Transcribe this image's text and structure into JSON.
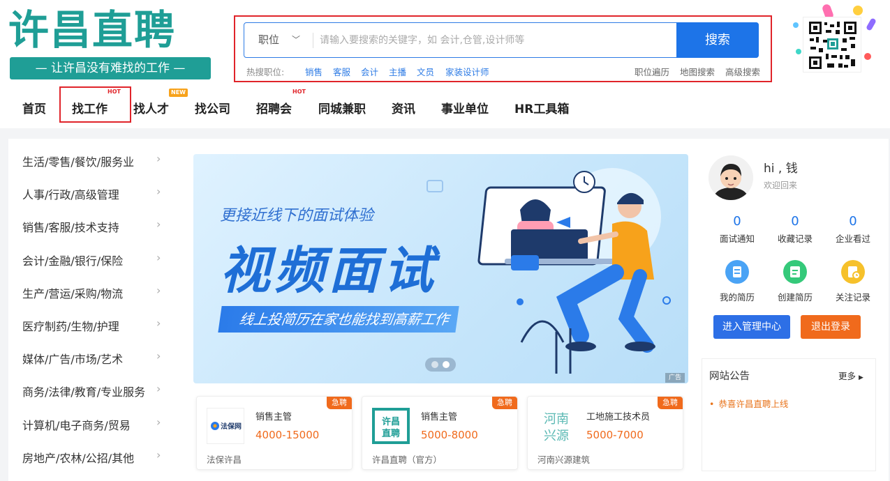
{
  "logo": {
    "title": "许昌直聘",
    "slogan": "— 让许昌没有难找的工作 —"
  },
  "search": {
    "type": "职位",
    "placeholder": "请输入要搜索的关键字，如 会计,仓管,设计师等",
    "button": "搜索",
    "hot_label": "热搜职位:",
    "hot_terms": [
      "销售",
      "客服",
      "会计",
      "主播",
      "文员",
      "家装设计师"
    ],
    "advanced": [
      "职位遍历",
      "地图搜索",
      "高级搜索"
    ]
  },
  "nav": {
    "items": [
      "首页",
      "找工作",
      "找人才",
      "找公司",
      "招聘会",
      "同城兼职",
      "资讯",
      "事业单位",
      "HR工具箱"
    ],
    "badges": {
      "find_job": "HOT",
      "find_talent": "NEW",
      "job_fair": "HOT"
    }
  },
  "categories": [
    "生活/零售/餐饮/服务业",
    "人事/行政/高级管理",
    "销售/客服/技术支持",
    "会计/金融/银行/保险",
    "生产/营运/采购/物流",
    "医疗制药/生物/护理",
    "媒体/广告/市场/艺术",
    "商务/法律/教育/专业服务",
    "计算机/电子商务/贸易",
    "房地产/农林/公招/其他"
  ],
  "banner": {
    "subtitle": "更接近线下的面试体验",
    "title": "视频面试",
    "tagline": "线上投简历在家也能找到高薪工作",
    "ad_label": "广告"
  },
  "jobs": [
    {
      "title": "销售主管",
      "salary": "4000-15000",
      "company": "法保许昌",
      "urgent": "急聘",
      "logo_text": "法保网"
    },
    {
      "title": "销售主管",
      "salary": "5000-8000",
      "company": "许昌直聘（官方）",
      "urgent": "急聘",
      "logo_text": "许昌直聘"
    },
    {
      "title": "工地施工技术员",
      "salary": "5000-7000",
      "company": "河南兴源建筑",
      "urgent": "急聘",
      "logo_text": "河南兴源"
    }
  ],
  "user": {
    "greeting": "hi , 钱",
    "welcome": "欢迎回来",
    "stats": [
      {
        "num": "0",
        "label": "面试通知"
      },
      {
        "num": "0",
        "label": "收藏记录"
      },
      {
        "num": "0",
        "label": "企业看过"
      }
    ],
    "quick": [
      {
        "label": "我的简历",
        "color": "#4aa3f5"
      },
      {
        "label": "创建简历",
        "color": "#35c97a"
      },
      {
        "label": "关注记录",
        "color": "#f6c12b"
      }
    ],
    "manage_button": "进入管理中心",
    "logout_button": "退出登录"
  },
  "notice": {
    "title": "网站公告",
    "more": "更多",
    "items": [
      "恭喜许昌直聘上线"
    ]
  },
  "colors": {
    "brand": "#1f9e96",
    "primary": "#1d74e8",
    "accent": "#f06a1c",
    "highlight_frame": "#e0242a"
  }
}
